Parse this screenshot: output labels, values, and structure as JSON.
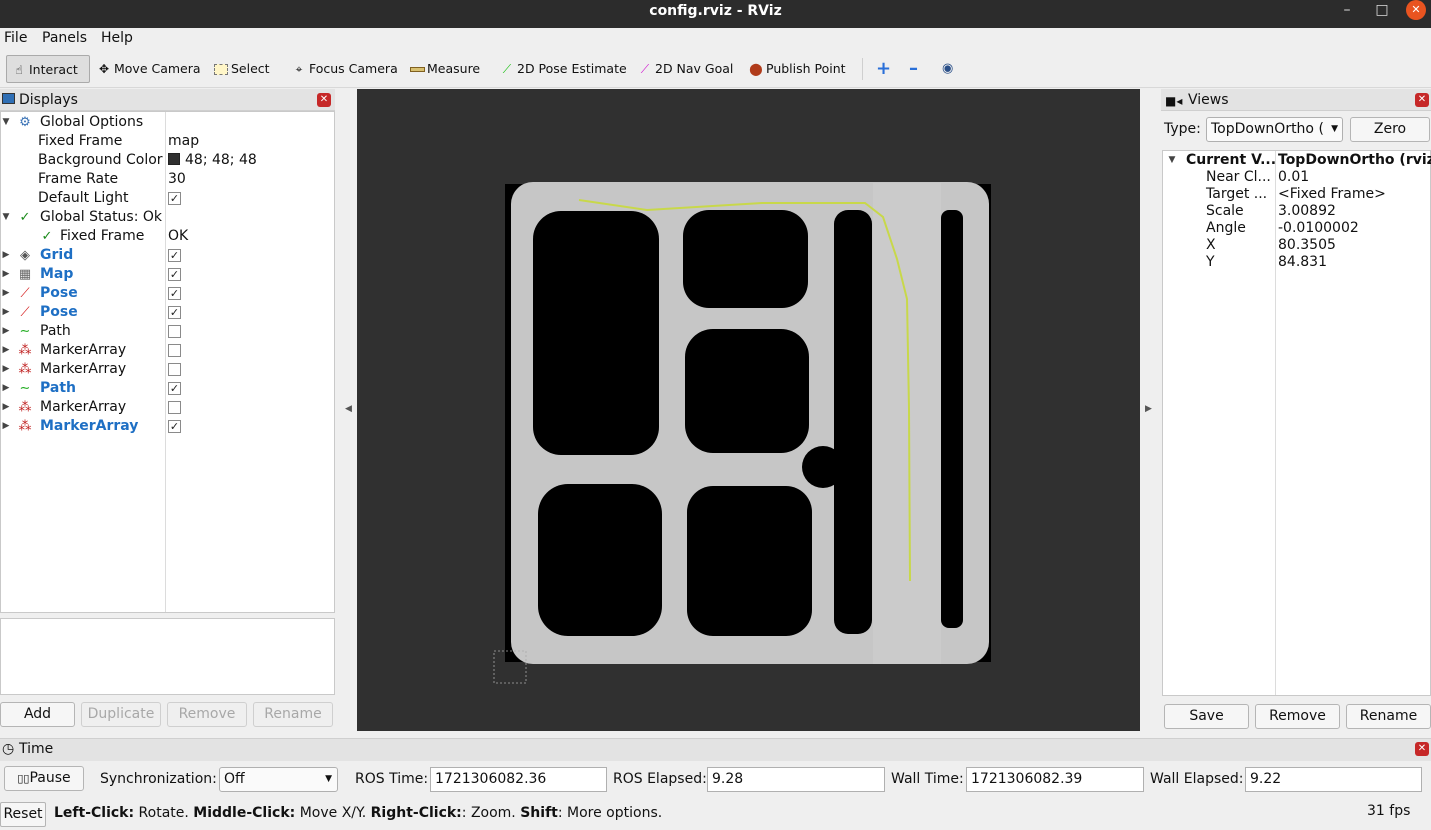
{
  "window": {
    "title": "config.rviz - RViz",
    "minimize": "–",
    "maximize": "□",
    "close": "✕"
  },
  "menubar": {
    "items": [
      "File",
      "Panels",
      "Help"
    ]
  },
  "toolbar": {
    "tools": [
      {
        "label": "Interact",
        "icon": "hand-pointer-icon",
        "active": true
      },
      {
        "label": "Move Camera",
        "icon": "move-camera-icon"
      },
      {
        "label": "Select",
        "icon": "select-icon"
      },
      {
        "label": "Focus Camera",
        "icon": "focus-camera-icon"
      },
      {
        "label": "Measure",
        "icon": "ruler-icon"
      },
      {
        "label": "2D Pose Estimate",
        "icon": "pose-estimate-arrow-icon",
        "color": "#21c21a"
      },
      {
        "label": "2D Nav Goal",
        "icon": "nav-goal-arrow-icon",
        "color": "#d01ad0"
      },
      {
        "label": "Publish Point",
        "icon": "map-pin-icon",
        "color": "#b03b1a"
      }
    ],
    "extra": {
      "add": "+",
      "remove": "–",
      "view": "◉"
    }
  },
  "displays": {
    "title": "Displays",
    "rows": [
      {
        "label": "Global Options",
        "icon": "gear-icon",
        "expanded": true,
        "level": 0
      },
      {
        "label": "Fixed Frame",
        "value": "map",
        "level": 1
      },
      {
        "label": "Background Color",
        "value": "48; 48; 48",
        "swatch": "#303030",
        "level": 1
      },
      {
        "label": "Frame Rate",
        "value": "30",
        "level": 1
      },
      {
        "label": "Default Light",
        "checked": true,
        "level": 1
      },
      {
        "label": "Global Status: Ok",
        "icon": "check-icon",
        "expanded": true,
        "level": 0
      },
      {
        "label": "Fixed Frame",
        "value": "OK",
        "icon": "check-icon",
        "level": 1
      },
      {
        "label": "Grid",
        "checked": true,
        "blue": true,
        "icon": "grid-icon",
        "level": 0
      },
      {
        "label": "Map",
        "checked": true,
        "blue": true,
        "icon": "map-icon",
        "level": 0
      },
      {
        "label": "Pose",
        "checked": true,
        "blue": true,
        "icon": "pose-arrow-icon",
        "level": 0
      },
      {
        "label": "Pose",
        "checked": true,
        "blue": true,
        "icon": "pose-arrow-icon",
        "level": 0
      },
      {
        "label": "Path",
        "checked": false,
        "blue": false,
        "icon": "path-icon",
        "level": 0
      },
      {
        "label": "MarkerArray",
        "checked": false,
        "blue": false,
        "icon": "marker-array-icon",
        "level": 0
      },
      {
        "label": "MarkerArray",
        "checked": false,
        "blue": false,
        "icon": "marker-array-icon",
        "level": 0
      },
      {
        "label": "Path",
        "checked": true,
        "blue": true,
        "icon": "path-icon",
        "level": 0
      },
      {
        "label": "MarkerArray",
        "checked": false,
        "blue": false,
        "icon": "marker-array-icon",
        "level": 0
      },
      {
        "label": "MarkerArray",
        "checked": true,
        "blue": true,
        "icon": "marker-array-icon",
        "level": 0
      }
    ],
    "buttons": {
      "add": "Add",
      "duplicate": "Duplicate",
      "remove": "Remove",
      "rename": "Rename"
    }
  },
  "views": {
    "title": "Views",
    "type_label": "Type:",
    "type_value": "TopDownOrtho (",
    "zero": "Zero",
    "current_label": "Current V...",
    "current_value": "TopDownOrtho (rviz)",
    "props": [
      {
        "label": "Near Cl...",
        "value": "0.01"
      },
      {
        "label": "Target ...",
        "value": "<Fixed Frame>"
      },
      {
        "label": "Scale",
        "value": "3.00892"
      },
      {
        "label": "Angle",
        "value": "-0.0100002"
      },
      {
        "label": "X",
        "value": "80.3505"
      },
      {
        "label": "Y",
        "value": "84.831"
      }
    ],
    "buttons": {
      "save": "Save",
      "remove": "Remove",
      "rename": "Rename"
    }
  },
  "time": {
    "title": "Time",
    "pause": "Pause",
    "sync_label": "Synchronization:",
    "sync_value": "Off",
    "ros_time_label": "ROS Time:",
    "ros_time": "1721306082.36",
    "ros_elapsed_label": "ROS Elapsed:",
    "ros_elapsed": "9.28",
    "wall_time_label": "Wall Time:",
    "wall_time": "1721306082.39",
    "wall_elapsed_label": "Wall Elapsed:",
    "wall_elapsed": "9.22"
  },
  "status": {
    "reset": "Reset",
    "hint_parts": [
      {
        "text": "Left-Click:",
        "bold": true
      },
      {
        "text": " Rotate. ",
        "bold": false
      },
      {
        "text": "Middle-Click:",
        "bold": true
      },
      {
        "text": " Move X/Y. ",
        "bold": false
      },
      {
        "text": "Right-Click:",
        "bold": true
      },
      {
        "text": ": Zoom. ",
        "bold": false
      },
      {
        "text": "Shift",
        "bold": true
      },
      {
        "text": ": More options.",
        "bold": false
      }
    ],
    "fps": "31 fps"
  },
  "viewport": {
    "background": "#303030",
    "map_free": "#c6c6c6",
    "map_occupied": "#000000",
    "path_color": "#c8d84a"
  }
}
